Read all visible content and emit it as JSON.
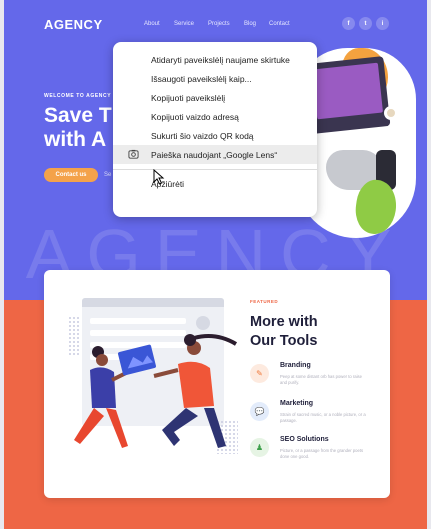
{
  "header": {
    "logo": "AGENCY",
    "nav": [
      "About",
      "Service",
      "Projects",
      "Blog",
      "Contact"
    ],
    "social": [
      "f",
      "t",
      "i"
    ]
  },
  "hero": {
    "welcome": "WELCOME TO AGENCY",
    "headline_line1": "Save T",
    "headline_line2": "with A",
    "contact_button": "Contact us",
    "secondary_link": "Se",
    "background_word": "AGENCY"
  },
  "context_menu": {
    "items": [
      "Atidaryti paveikslėlį naujame skirtuke",
      "Išsaugoti paveikslėlį kaip...",
      "Kopijuoti paveikslėlį",
      "Kopijuoti vaizdo adresą",
      "Sukurti šio vaizdo QR kodą",
      "Paieška naudojant „Google Lens“"
    ],
    "inspect": "Apžiūrėti",
    "hovered_index": 5
  },
  "tools": {
    "eyebrow": "FEATURED",
    "title_line1": "More with",
    "title_line2": "Our Tools",
    "features": [
      {
        "title": "Branding",
        "desc": "Peep at some distant orb has power to raise and purify.",
        "icon": "pen-icon"
      },
      {
        "title": "Marketing",
        "desc": "Strain of sacred music, or a noble picture, or a passage.",
        "icon": "chat-icon"
      },
      {
        "title": "SEO Solutions",
        "desc": "Picture, or a passage from the grander poets done one good.",
        "icon": "chess-icon"
      }
    ]
  },
  "colors": {
    "hero_bg": "#6468ea",
    "accent_orange": "#ee6645",
    "button": "#f4a24a"
  }
}
